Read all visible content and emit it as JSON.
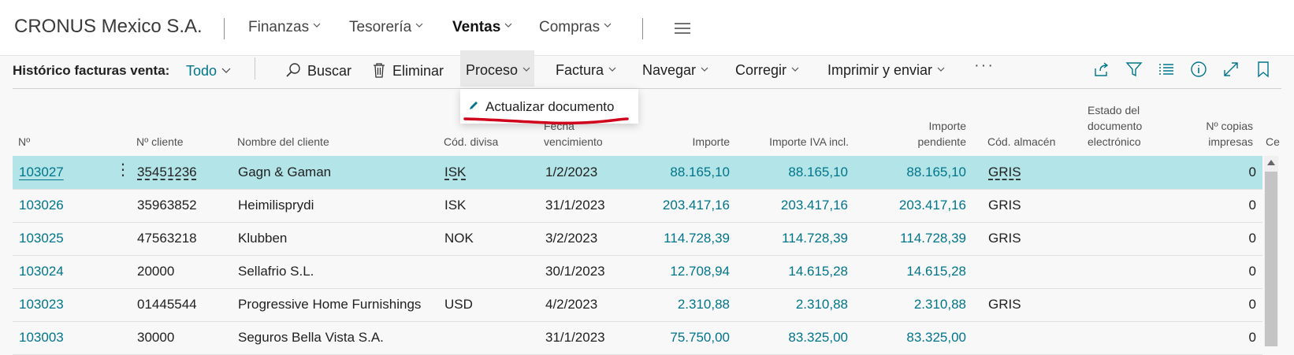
{
  "nav": {
    "company": "CRONUS Mexico S.A.",
    "menus": [
      "Finanzas",
      "Tesorería",
      "Ventas",
      "Compras"
    ]
  },
  "actionbar": {
    "page_title": "Histórico facturas venta:",
    "filter": "Todo",
    "actions": {
      "buscar": "Buscar",
      "eliminar": "Eliminar",
      "proceso": "Proceso",
      "factura": "Factura",
      "navegar": "Navegar",
      "corregir": "Corregir",
      "imprimir": "Imprimir y enviar"
    },
    "more": "···"
  },
  "dropdown": {
    "item": "Actualizar documento"
  },
  "table": {
    "headers": {
      "no": "Nº",
      "cliente": "Nº cliente",
      "nombre": "Nombre del cliente",
      "divisa": "Cód. divisa",
      "fecha": [
        "Fecha",
        "vencimiento"
      ],
      "importe": "Importe",
      "iva": "Importe IVA incl.",
      "pendiente": [
        "Importe",
        "pendiente"
      ],
      "almacen": "Cód. almacén",
      "estado": [
        "Estado del",
        "documento",
        "electrónico"
      ],
      "copias": [
        "Nº copias",
        "impresas"
      ],
      "extra": "Ce"
    },
    "rows": [
      {
        "no": "103027",
        "cliente": "35451236",
        "nombre": "Gagn & Gaman",
        "divisa": "ISK",
        "fecha": "1/2/2023",
        "importe": "88.165,10",
        "iva": "88.165,10",
        "pendiente": "88.165,10",
        "almacen": "GRIS",
        "copias": "0"
      },
      {
        "no": "103026",
        "cliente": "35963852",
        "nombre": "Heimilisprydi",
        "divisa": "ISK",
        "fecha": "31/1/2023",
        "importe": "203.417,16",
        "iva": "203.417,16",
        "pendiente": "203.417,16",
        "almacen": "GRIS",
        "copias": "0"
      },
      {
        "no": "103025",
        "cliente": "47563218",
        "nombre": "Klubben",
        "divisa": "NOK",
        "fecha": "3/2/2023",
        "importe": "114.728,39",
        "iva": "114.728,39",
        "pendiente": "114.728,39",
        "almacen": "GRIS",
        "copias": "0"
      },
      {
        "no": "103024",
        "cliente": "20000",
        "nombre": "Sellafrio S.L.",
        "divisa": "",
        "fecha": "30/1/2023",
        "importe": "12.708,94",
        "iva": "14.615,28",
        "pendiente": "14.615,28",
        "almacen": "",
        "copias": "0"
      },
      {
        "no": "103023",
        "cliente": "01445544",
        "nombre": "Progressive Home Furnishings",
        "divisa": "USD",
        "fecha": "4/2/2023",
        "importe": "2.310,88",
        "iva": "2.310,88",
        "pendiente": "2.310,88",
        "almacen": "GRIS",
        "copias": "0"
      },
      {
        "no": "103003",
        "cliente": "30000",
        "nombre": "Seguros Bella Vista S.A.",
        "divisa": "",
        "fecha": "31/1/2023",
        "importe": "75.750,00",
        "iva": "83.325,00",
        "pendiente": "83.325,00",
        "almacen": "",
        "copias": "0"
      }
    ]
  },
  "colors": {
    "accent": "#00758a",
    "selected_row": "#b3e5e8",
    "annotation": "#d0021b"
  }
}
